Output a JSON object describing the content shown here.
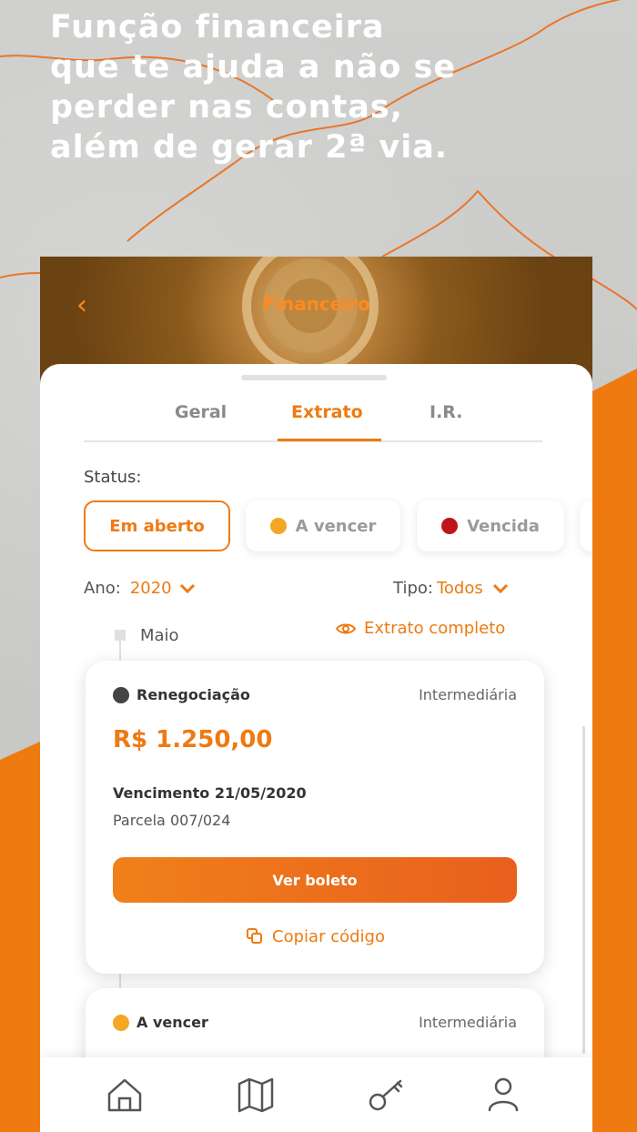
{
  "promo": {
    "headline_lines": [
      "Função financeira",
      "que te ajuda a não se",
      "perder nas contas,",
      "além de gerar 2ª via."
    ]
  },
  "header": {
    "back_icon": "chevron-left-icon",
    "title": "Financeiro"
  },
  "tabs": [
    {
      "label": "Geral",
      "active": false
    },
    {
      "label": "Extrato",
      "active": true
    },
    {
      "label": "I.R.",
      "active": false
    }
  ],
  "filters": {
    "status_label": "Status:",
    "chips": [
      {
        "label": "Em aberto",
        "selected": true,
        "dot_color": ""
      },
      {
        "label": "A vencer",
        "selected": false,
        "dot_color": "#f5a623"
      },
      {
        "label": "Vencida",
        "selected": false,
        "dot_color": "#c0141c"
      }
    ],
    "year_label": "Ano:",
    "year_value": "2020",
    "type_label": "Tipo:",
    "type_value": "Todos"
  },
  "timeline": {
    "month": "Maio",
    "full_statement_link": "Extrato completo"
  },
  "cards": [
    {
      "status": "Renegociação",
      "status_color": "#444444",
      "type": "Intermediária",
      "amount": "R$ 1.250,00",
      "due": "Vencimento 21/05/2020",
      "installment": "Parcela 007/024",
      "button": "Ver boleto",
      "copy": "Copiar código"
    },
    {
      "status": "A vencer",
      "status_color": "#f5a623",
      "type": "Intermediária"
    }
  ],
  "bottom_nav": [
    "home-icon",
    "map-icon",
    "key-icon",
    "user-icon"
  ],
  "colors": {
    "accent": "#ee7a12",
    "brand_orange": "#ef7a0f"
  }
}
